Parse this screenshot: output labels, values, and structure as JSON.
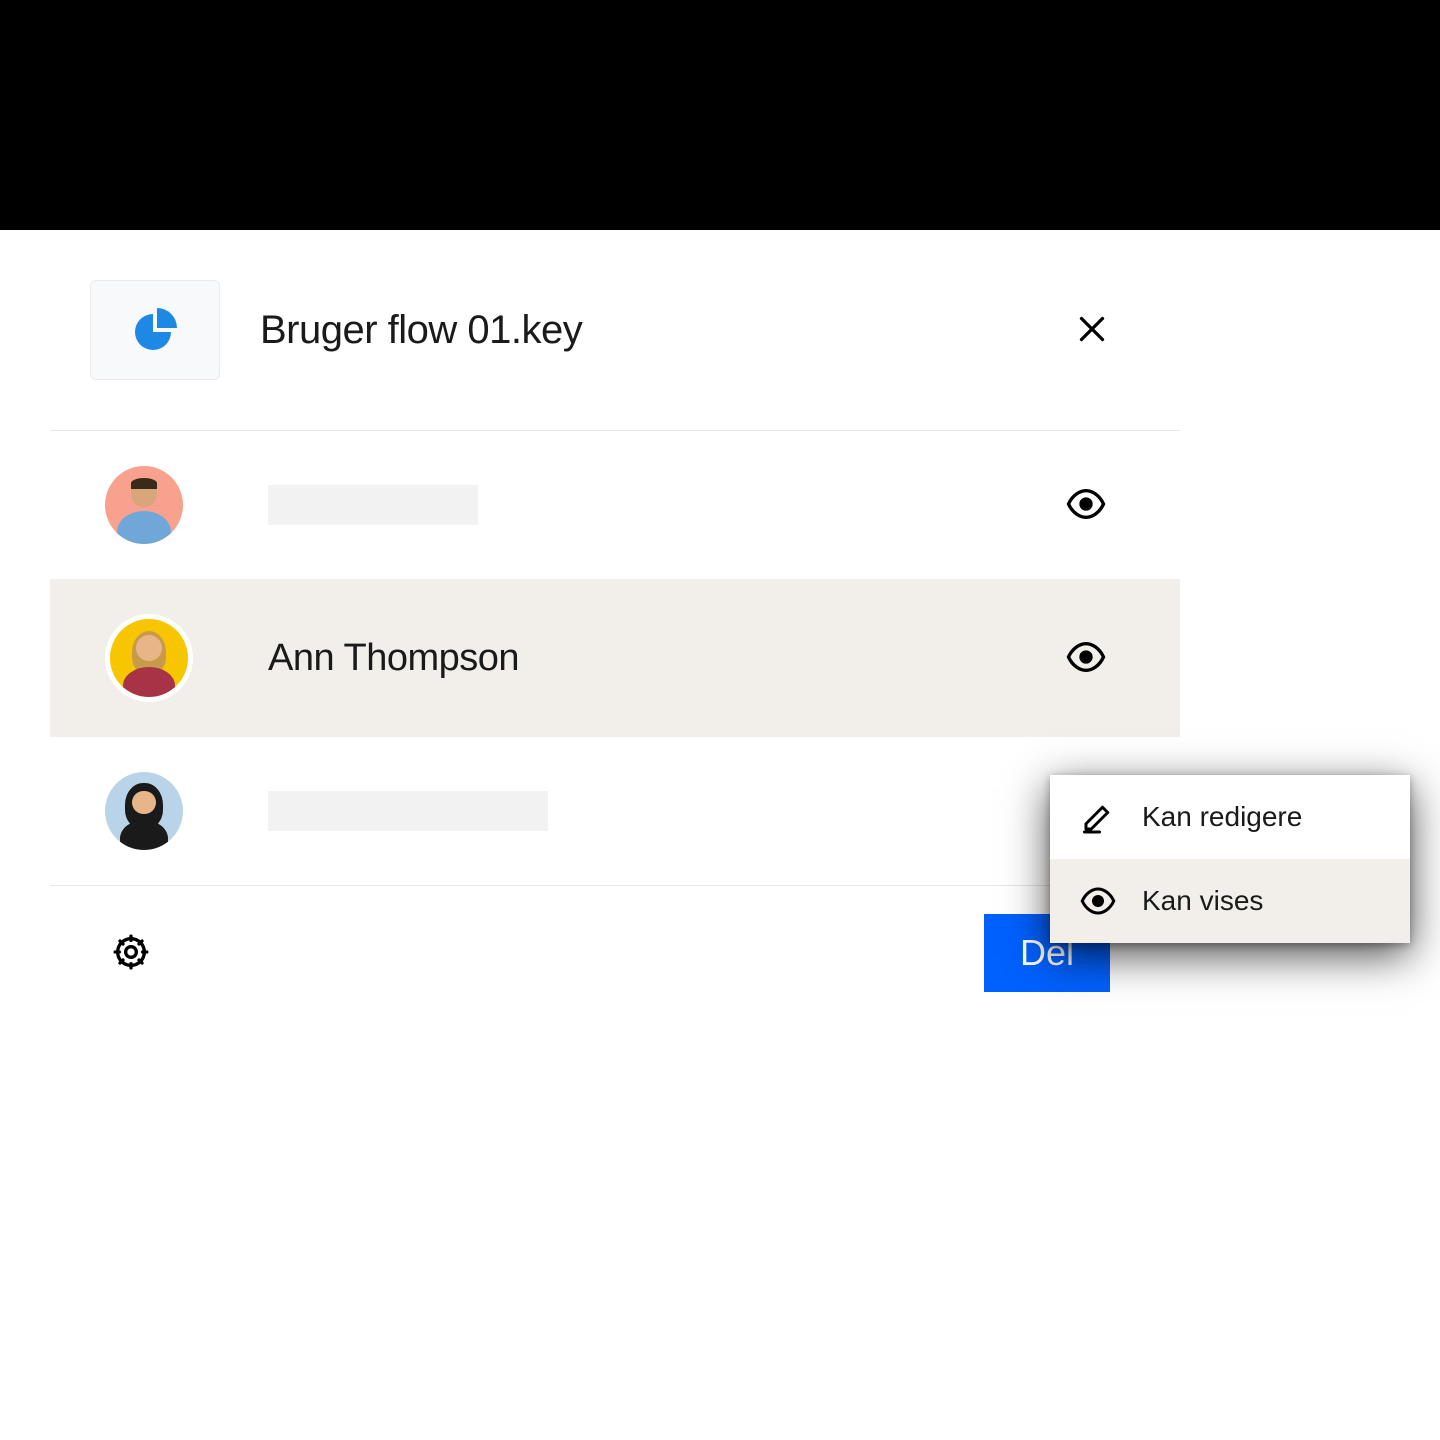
{
  "header": {
    "file_name": "Bruger flow 01.key"
  },
  "users": [
    {
      "name": "",
      "permission_icon": "eye",
      "avatar_bg": "#f8a18e"
    },
    {
      "name": "Ann Thompson",
      "permission_icon": "eye",
      "avatar_bg": "#f7c600",
      "highlighted": true
    },
    {
      "name": "",
      "permission_icon": "",
      "avatar_bg": "#b9d4e8"
    }
  ],
  "dropdown": {
    "items": [
      {
        "label": "Kan redigere",
        "icon": "pencil",
        "selected": false
      },
      {
        "label": "Kan vises",
        "icon": "eye",
        "selected": true
      }
    ]
  },
  "footer": {
    "share_label": "Del"
  },
  "colors": {
    "accent": "#0061fe",
    "highlight_bg": "#f2efea",
    "file_icon": "#1e88e5"
  }
}
